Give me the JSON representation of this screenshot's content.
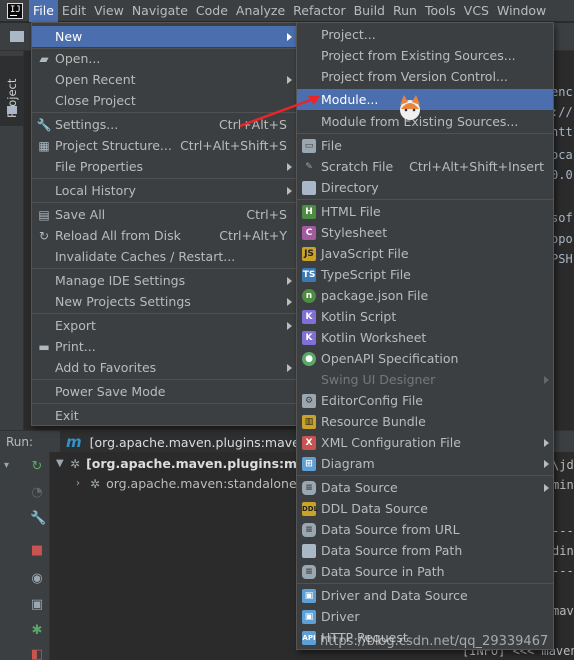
{
  "menubar": {
    "items": [
      "File",
      "Edit",
      "View",
      "Navigate",
      "Code",
      "Analyze",
      "Refactor",
      "Build",
      "Run",
      "Tools",
      "VCS",
      "Window"
    ]
  },
  "left_panel": {
    "tab_label": "Project"
  },
  "editor_fragments": [
    "enc",
    "://",
    "htt",
    "oca",
    "0.0",
    "sof",
    "opo",
    "PSH"
  ],
  "file_menu": {
    "new": "New",
    "open": "Open...",
    "open_recent": "Open Recent",
    "close_project": "Close Project",
    "settings": "Settings...",
    "settings_sc": "Ctrl+Alt+S",
    "project_structure": "Project Structure...",
    "project_structure_sc": "Ctrl+Alt+Shift+S",
    "file_properties": "File Properties",
    "local_history": "Local History",
    "save_all": "Save All",
    "save_all_sc": "Ctrl+S",
    "reload": "Reload All from Disk",
    "reload_sc": "Ctrl+Alt+Y",
    "invalidate": "Invalidate Caches / Restart...",
    "manage_ide": "Manage IDE Settings",
    "new_projects": "New Projects Settings",
    "export": "Export",
    "print": "Print...",
    "add_fav": "Add to Favorites",
    "power_save": "Power Save Mode",
    "exit": "Exit"
  },
  "new_menu": {
    "project": "Project...",
    "from_existing": "Project from Existing Sources...",
    "from_vcs": "Project from Version Control...",
    "module": "Module...",
    "module_existing": "Module from Existing Sources...",
    "file": "File",
    "scratch": "Scratch File",
    "scratch_sc": "Ctrl+Alt+Shift+Insert",
    "directory": "Directory",
    "html": "HTML File",
    "stylesheet": "Stylesheet",
    "js": "JavaScript File",
    "ts": "TypeScript File",
    "packagejson": "package.json File",
    "kotlin_script": "Kotlin Script",
    "kotlin_ws": "Kotlin Worksheet",
    "openapi": "OpenAPI Specification",
    "swing": "Swing UI Designer",
    "editorconfig": "EditorConfig File",
    "resource_bundle": "Resource Bundle",
    "xml_config": "XML Configuration File",
    "diagram": "Diagram",
    "data_source": "Data Source",
    "ddl": "DDL Data Source",
    "ds_url": "Data Source from URL",
    "ds_path": "Data Source from Path",
    "ds_in_path": "Data Source in Path",
    "driver_ds": "Driver and Data Source",
    "driver": "Driver",
    "http": "HTTP Request"
  },
  "run_panel": {
    "label": "Run:",
    "tab": "[org.apache.maven.plugins:maven",
    "tree_root": "[org.apache.maven.plugins:maven",
    "tree_child": "org.apache.maven:standalone-p"
  },
  "console_fragments": [
    "\\jd",
    "min",
    "---",
    "din",
    "---",
    "mav"
  ],
  "console_bottom": "[INFO] <<< maven",
  "watermark": "https://blog.csdn.net/qq_29339467",
  "colors": {
    "highlight": "#4b6eaf",
    "menu_bg": "#3c3f41",
    "arrow": "#e8262a"
  }
}
